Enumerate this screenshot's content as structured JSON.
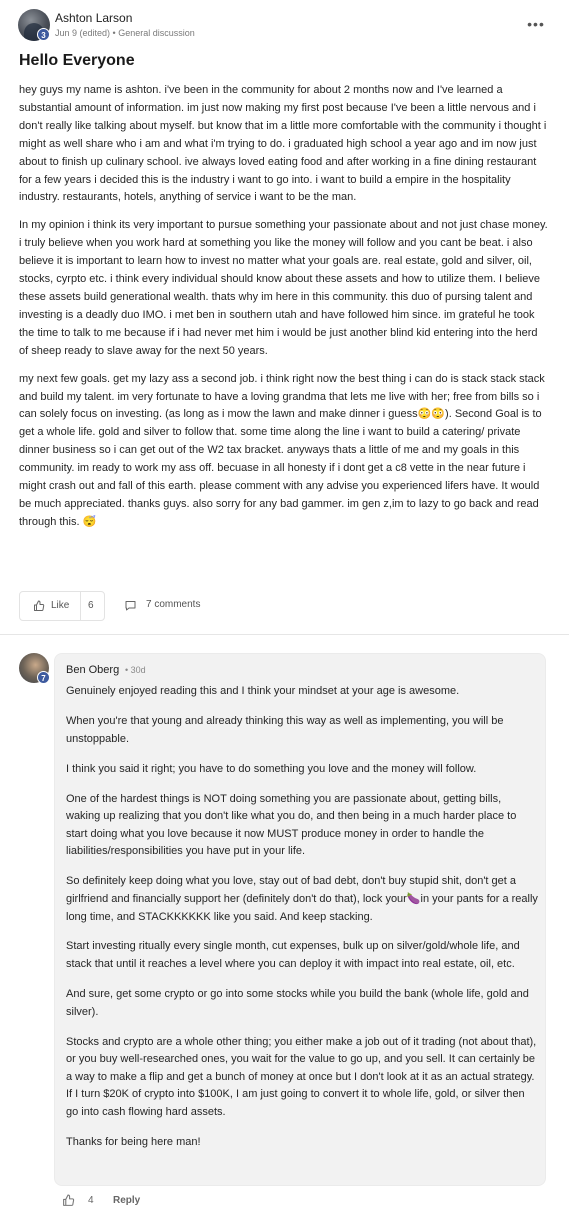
{
  "post": {
    "author": "Ashton Larson",
    "level": "3",
    "date": "Jun 9 (edited)",
    "separator": " • ",
    "category": "General discussion",
    "more_label": "•••",
    "title": "Hello Everyone",
    "paragraphs": [
      "hey guys my name is ashton. i've been in the community for about 2 months now and I've learned a substantial amount of information. im just now making my first post because I've been a little nervous and i don't really like talking about myself. but know that im a little more comfortable with the community i thought i might as well share who i am and what i'm trying to do. i graduated high school a year ago and im now just about to finish up culinary school. ive always loved eating food and after working in a fine dining restaurant for a few years i decided this is the industry i want to go into. i want to build a empire in the hospitality industry. restaurants, hotels, anything of service i want to be the man.",
      "In my opinion i think its very important to pursue something your passionate about and not just chase money. i truly believe when you work hard at something you like the money will follow and you cant be beat. i also believe it is important to learn how to invest no matter what your goals are. real estate, gold and silver, oil, stocks, cyrpto etc. i think every individual should know about these assets and how to utilize them. I believe these assets build generational wealth. thats why im here in this community. this duo of pursing talent and investing is a deadly duo IMO. i met ben in southern utah and have followed him since. im grateful he took the time to talk to me because if i had never met him i would be just another blind kid entering into the herd of sheep ready to slave away for the next 50 years.",
      "my next few goals. get my lazy ass a second job. i think right now the best thing i can do is stack stack stack and build my talent. im very fortunate to have a loving grandma that lets me live with her; free from bills so i can solely focus on investing. (as long as i mow the lawn and make dinner i guess😳😳). Second Goal is to get a whole life. gold and silver to follow that. some time along the line i want to build a catering/ private dinner business so i can get out of the W2 tax bracket. anyways thats a little of me and my goals in this community. im ready to work my ass off. becuase in all honesty if i dont get a c8 vette in the near future i might crash out and fall of this earth. please comment with any advise you experienced lifers have. It would be much appreciated. thanks guys. also sorry for any bad gammer. im gen z,im to lazy to go back and read through this. 😴"
    ],
    "like_label": "Like",
    "like_count": "6",
    "comments_label": "7 comments"
  },
  "comment": {
    "author": "Ben Oberg",
    "level": "7",
    "time": "• 30d",
    "paragraphs": [
      "Genuinely enjoyed reading this and I think your mindset at your age is awesome.",
      "When you're that young and already thinking this way as well as implementing, you will be unstoppable.",
      "I think you said it right; you have to do something you love and the money will follow.",
      "One of the hardest things is NOT doing something you are passionate about, getting bills, waking up realizing that you don't like what you do, and then being in a much harder place to start doing what you love because it now MUST produce money in order to handle the liabilities/responsibilities you have put in your life.",
      "So definitely keep doing what you love, stay out of bad debt, don't buy stupid shit, don't get a girlfriend and financially support her (definitely don't do that), lock your🍆in your pants for a really long time, and STACKKKKKK like you said. And keep stacking.",
      "Start investing ritually every single month, cut expenses, bulk up on silver/gold/whole life, and stack that until it reaches a level where you can deploy it with impact into real estate, oil, etc.",
      "And sure, get some crypto or go into some stocks while you build the bank (whole life, gold and silver).",
      "Stocks and crypto are a whole other thing; you either make a job out of it trading (not about that), or you buy well-researched ones, you wait for the value to go up, and you sell. It can certainly be a way to make a flip and get a bunch of money at once but I don't look at it as an actual strategy. If I turn $20K of crypto into $100K, I am just going to convert it to whole life, gold, or silver then go into cash flowing hard assets.",
      "Thanks for being here man!"
    ],
    "like_count": "4",
    "reply_label": "Reply"
  },
  "icons": {
    "more": "more-icon",
    "like": "thumbs-up-icon",
    "comments": "comment-bubble-icon"
  }
}
